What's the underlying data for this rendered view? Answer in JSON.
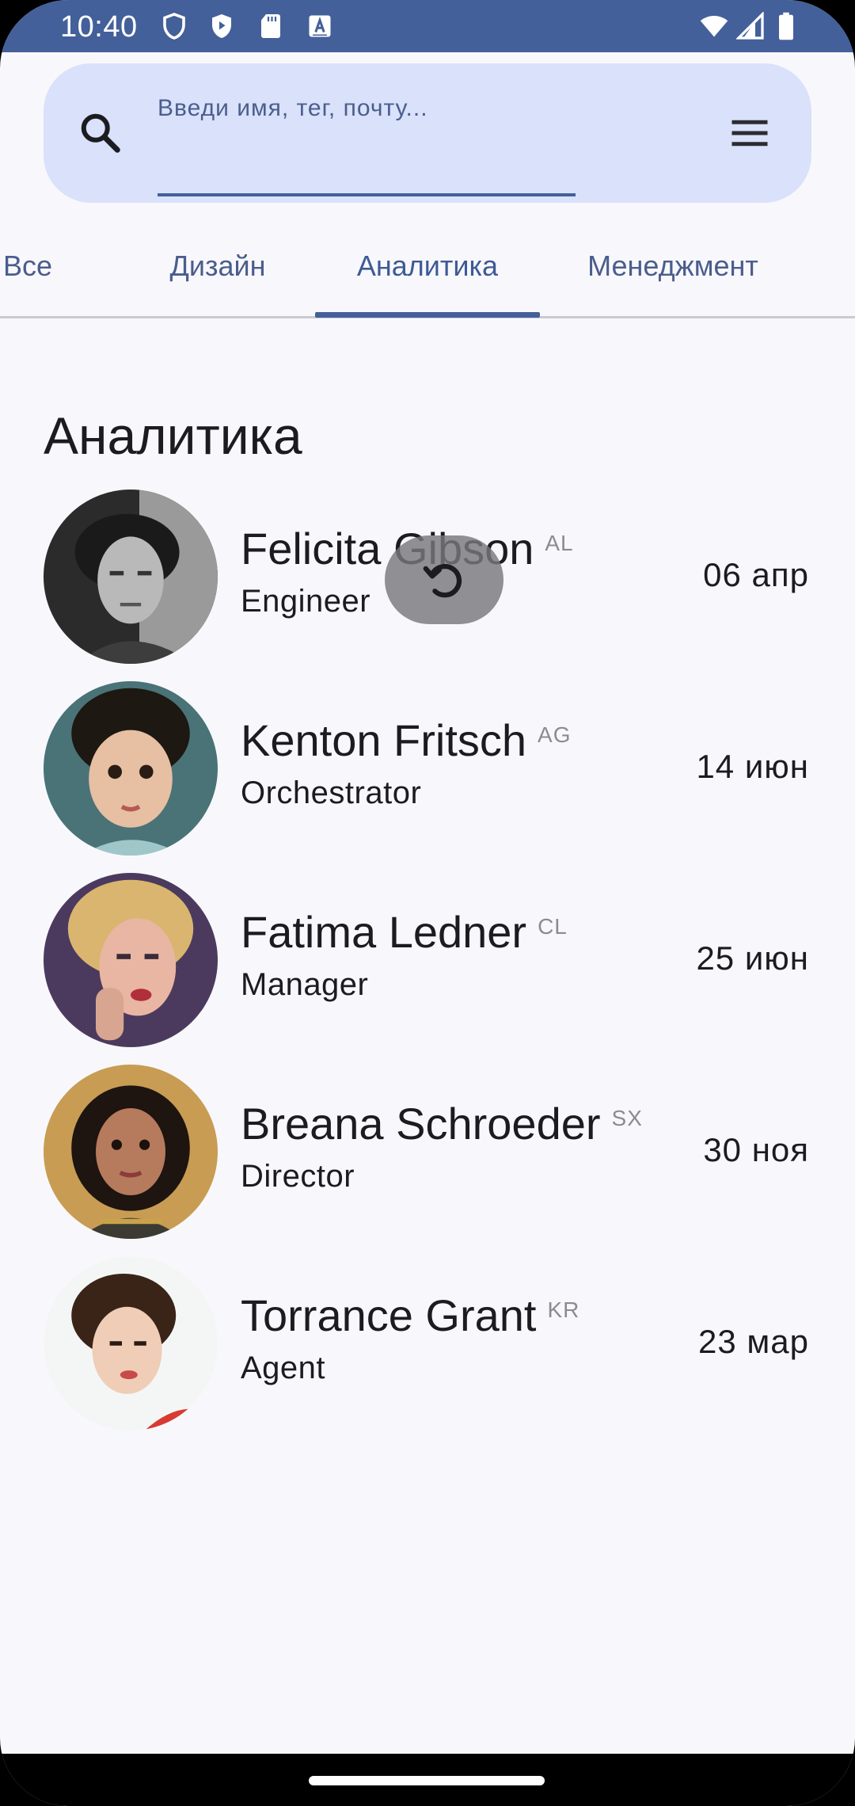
{
  "status_bar": {
    "time": "10:40",
    "icons": [
      "shield-outline-icon",
      "shield-play-icon",
      "sd-card-icon",
      "keyboard-a-icon",
      "wifi-icon",
      "signal-icon",
      "battery-icon"
    ]
  },
  "search": {
    "placeholder": "Введи имя, тег, почту...",
    "value": ""
  },
  "tabs": [
    {
      "label": "Все",
      "active": false
    },
    {
      "label": "Дизайн",
      "active": false
    },
    {
      "label": "Аналитика",
      "active": true
    },
    {
      "label": "Менеджмент",
      "active": false
    }
  ],
  "section": {
    "title": "Аналитика"
  },
  "people": [
    {
      "name": "Felicita Gibson",
      "code": "AL",
      "role": "Engineer",
      "date": "06 апр"
    },
    {
      "name": "Kenton Fritsch",
      "code": "AG",
      "role": "Orchestrator",
      "date": "14 июн"
    },
    {
      "name": "Fatima Ledner",
      "code": "CL",
      "role": "Manager",
      "date": "25 июн"
    },
    {
      "name": "Breana Schroeder",
      "code": "SX",
      "role": "Director",
      "date": "30 ноя"
    },
    {
      "name": "Torrance Grant",
      "code": "KR",
      "role": "Agent",
      "date": "23 мар"
    }
  ],
  "colors": {
    "primary": "#44609a",
    "search_bg": "#d9e1fb",
    "background": "#f8f8fc",
    "text": "#1c1c20"
  }
}
